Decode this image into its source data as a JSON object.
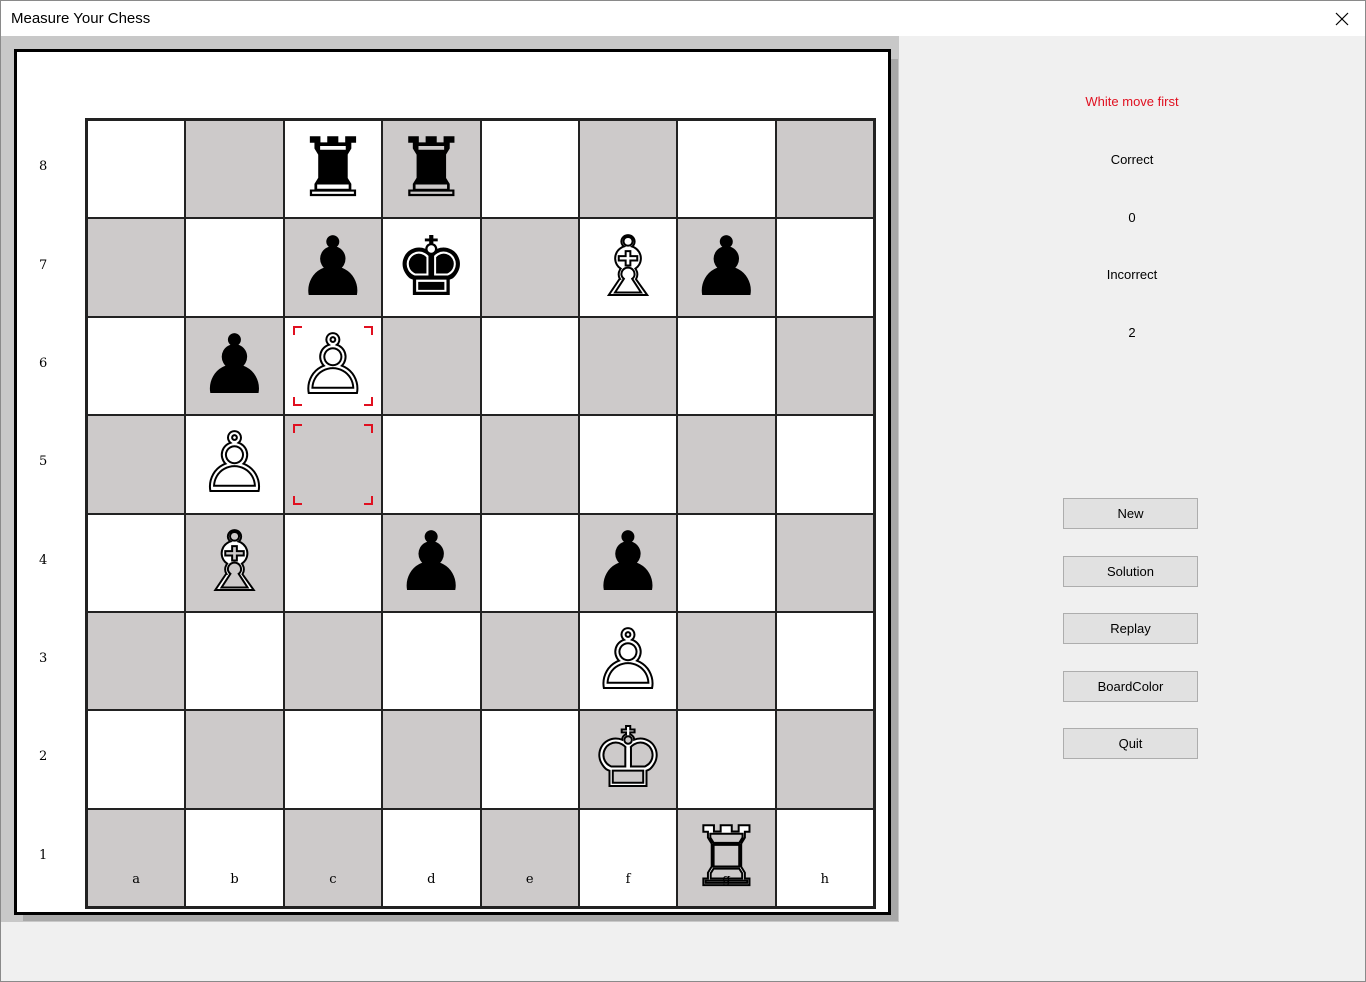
{
  "window": {
    "title": "Measure Your Chess"
  },
  "board": {
    "ranks": [
      "8",
      "7",
      "6",
      "5",
      "4",
      "3",
      "2",
      "1"
    ],
    "files": [
      "a",
      "b",
      "c",
      "d",
      "e",
      "f",
      "g",
      "h"
    ],
    "pieces": {
      "c8": {
        "color": "black",
        "type": "rook",
        "glyph": "♜"
      },
      "d8": {
        "color": "black",
        "type": "rook",
        "glyph": "♜"
      },
      "c7": {
        "color": "black",
        "type": "pawn",
        "glyph": "♟"
      },
      "d7": {
        "color": "black",
        "type": "king",
        "glyph": "♚"
      },
      "f7": {
        "color": "white",
        "type": "bishop",
        "glyph": "♗"
      },
      "g7": {
        "color": "black",
        "type": "pawn",
        "glyph": "♟"
      },
      "b6": {
        "color": "black",
        "type": "pawn",
        "glyph": "♟"
      },
      "c6": {
        "color": "white",
        "type": "pawn",
        "glyph": "♙"
      },
      "b5": {
        "color": "white",
        "type": "pawn",
        "glyph": "♙"
      },
      "b4": {
        "color": "white",
        "type": "bishop",
        "glyph": "♗"
      },
      "d4": {
        "color": "black",
        "type": "pawn",
        "glyph": "♟"
      },
      "f4": {
        "color": "black",
        "type": "pawn",
        "glyph": "♟"
      },
      "f3": {
        "color": "white",
        "type": "pawn",
        "glyph": "♙"
      },
      "f2": {
        "color": "white",
        "type": "king",
        "glyph": "♔"
      },
      "g1": {
        "color": "white",
        "type": "rook",
        "glyph": "♖"
      }
    },
    "highlighted": [
      "c6",
      "c5"
    ],
    "colors": {
      "light": "#ffffff",
      "dark": "#cdcaca",
      "highlight": "#e01020"
    }
  },
  "side": {
    "status": "White move first",
    "correct_label": "Correct",
    "correct_value": "0",
    "incorrect_label": "Incorrect",
    "incorrect_value": "2",
    "buttons": {
      "new": "New",
      "solution": "Solution",
      "replay": "Replay",
      "boardcolor": "BoardColor",
      "quit": "Quit"
    }
  }
}
